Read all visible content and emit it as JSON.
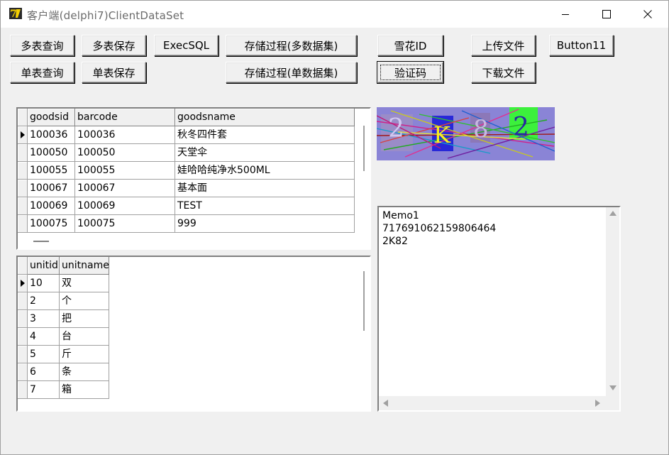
{
  "window": {
    "title": "客户端(delphi7)ClientDataSet",
    "icon": "delphi7-app-icon",
    "controls": {
      "minimize": "minimize-icon",
      "maximize": "maximize-icon",
      "close": "close-icon"
    }
  },
  "buttons": {
    "multi_query": "多表查询",
    "multi_save": "多表保存",
    "exec_sql": "ExecSQL",
    "stored_proc_multi": "存储过程(多数据集)",
    "snowflake_id": "雪花ID",
    "upload_file": "上传文件",
    "button11": "Button11",
    "single_query": "单表查询",
    "single_save": "单表保存",
    "stored_proc_single": "存储过程(单数据集)",
    "captcha": "验证码",
    "download_file": "下载文件"
  },
  "goods_grid": {
    "columns": [
      "goodsid",
      "barcode",
      "goodsname"
    ],
    "rows": [
      [
        "100036",
        "100036",
        "秋冬四件套"
      ],
      [
        "100050",
        "100050",
        "天堂伞"
      ],
      [
        "100055",
        "100055",
        "娃哈哈纯净水500ML"
      ],
      [
        "100067",
        "100067",
        "基本面"
      ],
      [
        "100069",
        "100069",
        "TEST"
      ],
      [
        "100075",
        "100075",
        "999"
      ]
    ],
    "current_row": 0
  },
  "unit_grid": {
    "columns": [
      "unitid",
      "unitname"
    ],
    "rows": [
      [
        "10",
        "双"
      ],
      [
        "2",
        "个"
      ],
      [
        "3",
        "把"
      ],
      [
        "4",
        "台"
      ],
      [
        "5",
        "斤"
      ],
      [
        "6",
        "条"
      ],
      [
        "7",
        "箱"
      ]
    ],
    "current_row": 0
  },
  "captcha_image": {
    "chars": [
      "2",
      "K",
      "8",
      "2"
    ],
    "colors": {
      "background": "#8a84d6",
      "char1": "#9a8cc8",
      "char2": "#2828d8",
      "char3": "#8c78b8",
      "char4": "#3cf03c"
    }
  },
  "memo": {
    "lines": [
      "Memo1",
      "717691062159806464",
      "2K82"
    ]
  }
}
